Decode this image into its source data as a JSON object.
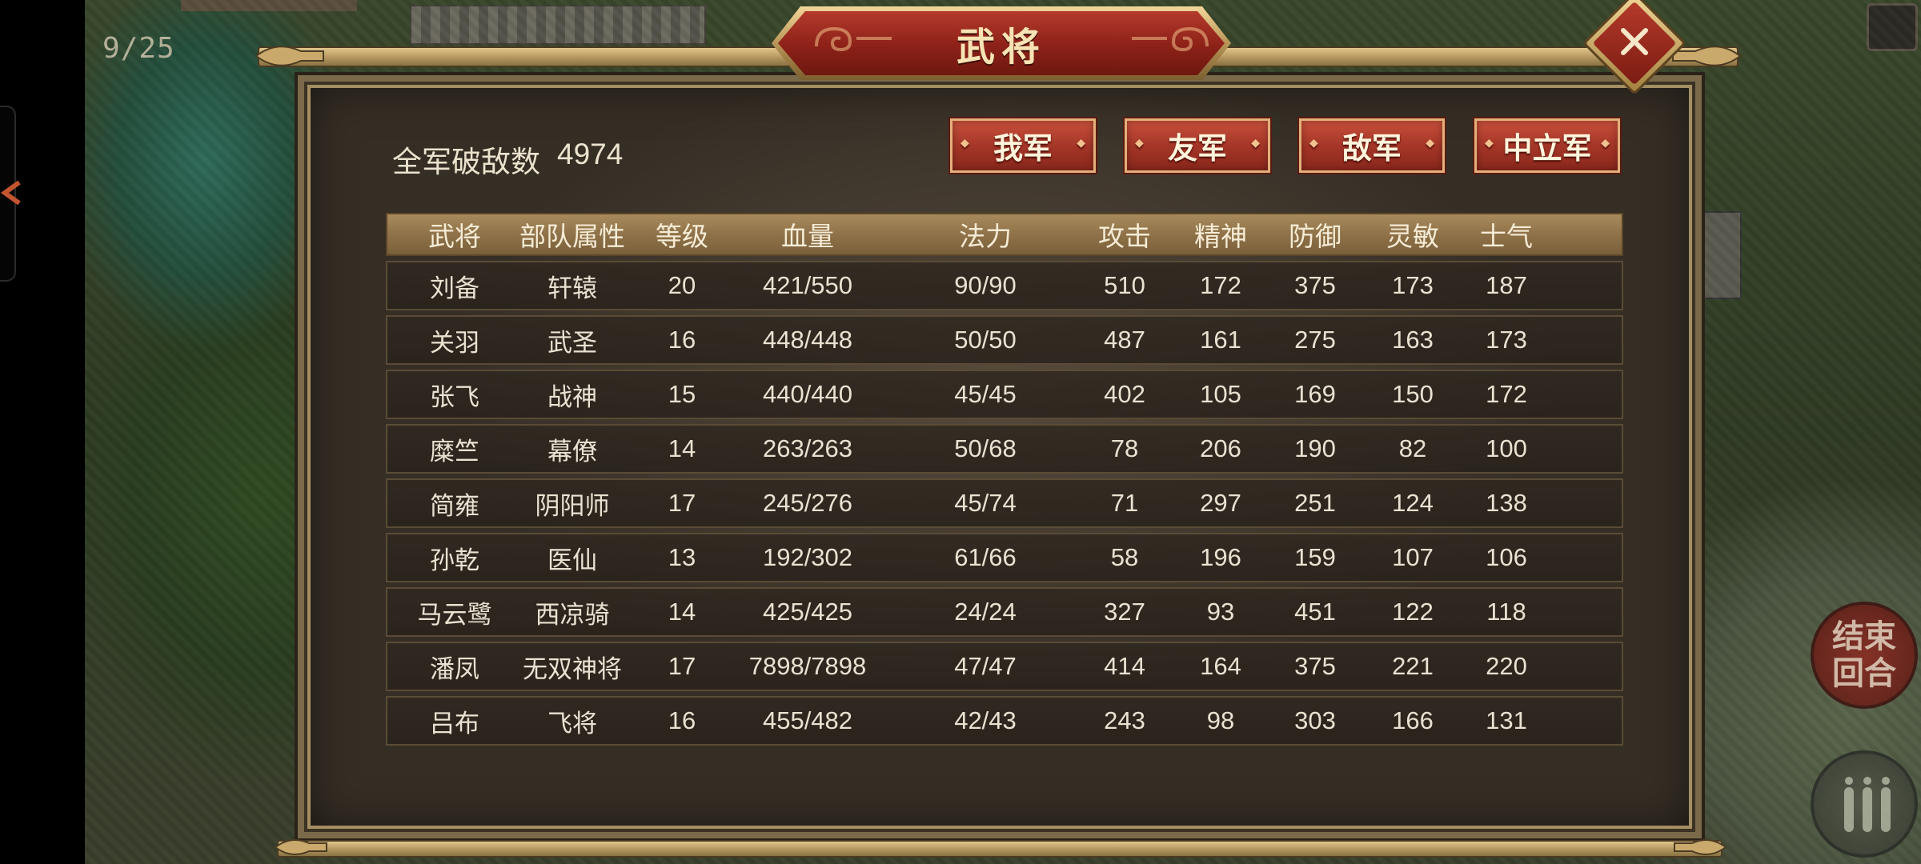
{
  "game": {
    "turn_counter": "9/25",
    "end_turn_label": "结束回合"
  },
  "panel": {
    "title": "武将",
    "kill_label": "全军破敌数",
    "kill_value": "4974",
    "factions": [
      "我军",
      "友军",
      "敌军",
      "中立军"
    ]
  },
  "table": {
    "headers": [
      "武将",
      "部队属性",
      "等级",
      "血量",
      "法力",
      "攻击",
      "精神",
      "防御",
      "灵敏",
      "士气"
    ],
    "rows": [
      [
        "刘备",
        "轩辕",
        "20",
        "421/550",
        "90/90",
        "510",
        "172",
        "375",
        "173",
        "187"
      ],
      [
        "关羽",
        "武圣",
        "16",
        "448/448",
        "50/50",
        "487",
        "161",
        "275",
        "163",
        "173"
      ],
      [
        "张飞",
        "战神",
        "15",
        "440/440",
        "45/45",
        "402",
        "105",
        "169",
        "150",
        "172"
      ],
      [
        "糜竺",
        "幕僚",
        "14",
        "263/263",
        "50/68",
        "78",
        "206",
        "190",
        "82",
        "100"
      ],
      [
        "简雍",
        "阴阳师",
        "17",
        "245/276",
        "45/74",
        "71",
        "297",
        "251",
        "124",
        "138"
      ],
      [
        "孙乾",
        "医仙",
        "13",
        "192/302",
        "61/66",
        "58",
        "196",
        "159",
        "107",
        "106"
      ],
      [
        "马云鹭",
        "西凉骑",
        "14",
        "425/425",
        "24/24",
        "327",
        "93",
        "451",
        "122",
        "118"
      ],
      [
        "潘凤",
        "无双神将",
        "17",
        "7898/7898",
        "47/47",
        "414",
        "164",
        "375",
        "221",
        "220"
      ],
      [
        "吕布",
        "飞将",
        "16",
        "455/482",
        "42/43",
        "243",
        "98",
        "303",
        "166",
        "131"
      ]
    ]
  },
  "colors": {
    "title_red": "#8c2118",
    "gold": "#b79a62",
    "panel_bg": "#433a2f",
    "header_bg": "#8f7249",
    "text": "#e9e2d2"
  }
}
